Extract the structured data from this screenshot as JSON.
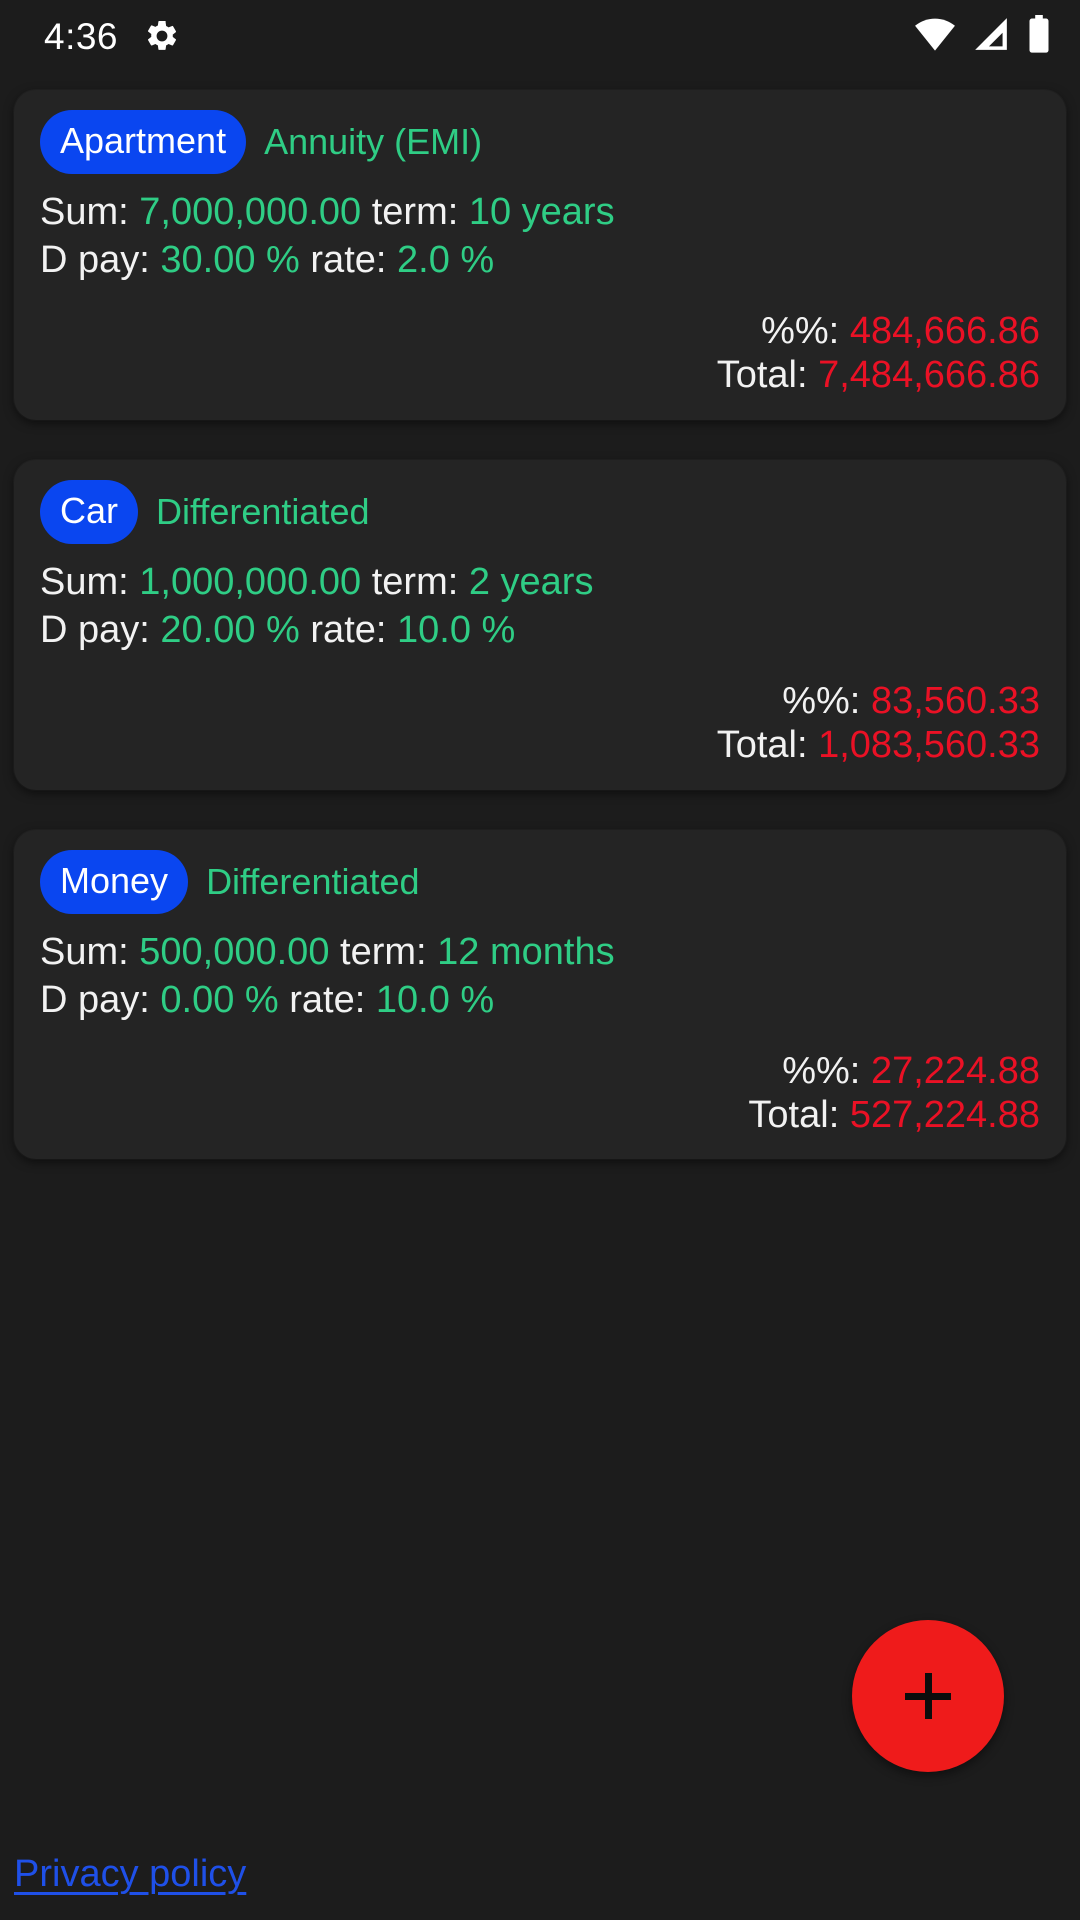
{
  "status_bar": {
    "time": "4:36",
    "gear_icon": "gear-icon",
    "wifi_icon": "wifi-icon",
    "signal_icon": "cell-signal-icon",
    "battery_icon": "battery-full-icon"
  },
  "colors": {
    "page_background": "#1c1c1c",
    "card_background": "#242424",
    "badge_blue": "#0a46f0",
    "value_green": "#2fcd85",
    "total_red": "#ea1125",
    "fab_red": "#ef1b1b",
    "link_blue": "#1f50e8",
    "label_white": "#f2f2f2"
  },
  "labels": {
    "sum": "Sum:",
    "term": "term:",
    "down_payment": "D pay:",
    "rate": "rate:",
    "interest": "%%:",
    "total": "Total:"
  },
  "loans": [
    {
      "badge": "Apartment",
      "type": "Annuity (EMI)",
      "sum": "7,000,000.00",
      "term": "10 years",
      "down_payment": "30.00 %",
      "rate": "2.0 %",
      "interest": "484,666.86",
      "total": "7,484,666.86"
    },
    {
      "badge": "Car",
      "type": "Differentiated",
      "sum": "1,000,000.00",
      "term": "2 years",
      "down_payment": "20.00 %",
      "rate": "10.0 %",
      "interest": "83,560.33",
      "total": "1,083,560.33"
    },
    {
      "badge": "Money",
      "type": "Differentiated",
      "sum": "500,000.00",
      "term": "12 months",
      "down_payment": "0.00 %",
      "rate": "10.0 %",
      "interest": "27,224.88",
      "total": "527,224.88"
    }
  ],
  "fab": {
    "icon": "plus-icon",
    "label": "+"
  },
  "footer": {
    "privacy_policy": "Privacy policy"
  }
}
